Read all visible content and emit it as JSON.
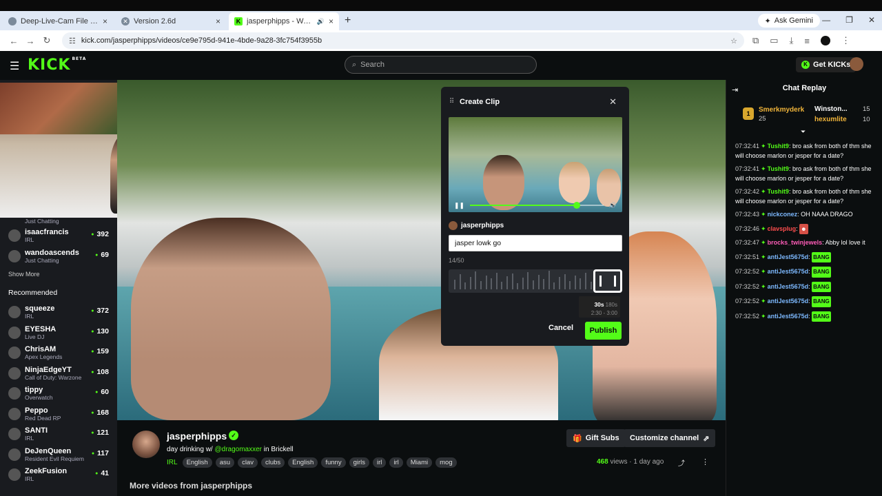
{
  "browser": {
    "tabs": [
      {
        "title": "Deep-Live-Cam File Error"
      },
      {
        "title": "Version 2.6d"
      },
      {
        "title": "jasperphipps - Watch the V"
      }
    ],
    "gemini_label": "Ask Gemini",
    "url": "kick.com/jasperphipps/videos/ce9e795d-941e-4bde-9a28-3fc754f3955b"
  },
  "header": {
    "logo": "KICK",
    "logo_badge": "BETA",
    "search_placeholder": "Search",
    "get_kicks_label": "Get KICKs"
  },
  "sidebar": {
    "following_top_category": "Just Chatting",
    "following": [
      {
        "name": "isaacfrancis",
        "category": "IRL",
        "viewers": "392"
      },
      {
        "name": "wandoascends",
        "category": "Just Chatting",
        "viewers": "69"
      }
    ],
    "show_more": "Show More",
    "recommended_title": "Recommended",
    "recommended": [
      {
        "name": "squeeze",
        "category": "IRL",
        "viewers": "372"
      },
      {
        "name": "EYESHA",
        "category": "Live DJ",
        "viewers": "130"
      },
      {
        "name": "ChrisAM",
        "category": "Apex Legends",
        "viewers": "159"
      },
      {
        "name": "NinjaEdgeYT",
        "category": "Call of Duty: Warzone",
        "viewers": "108"
      },
      {
        "name": "tippy",
        "category": "Overwatch",
        "viewers": "60"
      },
      {
        "name": "Peppo",
        "category": "Red Dead RP",
        "viewers": "168"
      },
      {
        "name": "SANTI",
        "category": "IRL",
        "viewers": "121"
      },
      {
        "name": "DeJenQueen",
        "category": "Resident Evil Requiem",
        "viewers": "117"
      },
      {
        "name": "ZeekFusion",
        "category": "IRL",
        "viewers": "41"
      }
    ]
  },
  "clip_modal": {
    "title": "Create Clip",
    "channel": "jasperphipps",
    "input_value": "jasper lowk go",
    "char_count": "14/50",
    "duration_selected": "30s",
    "duration_max": "180s",
    "range": "2:30 - 3:00",
    "cancel_label": "Cancel",
    "publish_label": "Publish",
    "playback_progress": 0.8
  },
  "chat": {
    "title": "Chat Replay",
    "leaders": [
      {
        "rank": "1",
        "name": "Smerkmyderk",
        "count": "25"
      },
      {
        "name": "Winston...",
        "count": "15"
      },
      {
        "name": "hexumlite",
        "count": "10"
      }
    ],
    "messages": [
      {
        "time": "07:32:41",
        "user": "Tushit9",
        "user_color": "#53fc18",
        "text": "bro ask from both of thm she will choose marlon or jesper for a date?"
      },
      {
        "time": "07:32:41",
        "user": "Tushit9",
        "user_color": "#53fc18",
        "text": "bro ask from both of thm she will choose marlon or jesper for a date?"
      },
      {
        "time": "07:32:42",
        "user": "Tushit9",
        "user_color": "#53fc18",
        "text": "bro ask from both of thm she will choose marlon or jesper for a date?"
      },
      {
        "time": "07:32:43",
        "user": "nickconez",
        "user_color": "#7db9ff",
        "text": "OH NAAA DRAGO"
      },
      {
        "time": "07:32:46",
        "user": "clavsplug",
        "user_color": "#ff4d4d",
        "text": ""
      },
      {
        "time": "07:32:47",
        "user": "brocks_twinjewels",
        "user_color": "#ff5cb8",
        "text": "Abby lol love it"
      },
      {
        "time": "07:32:51",
        "user": "antiJest5675d",
        "user_color": "#7db9ff",
        "text": "BANG"
      },
      {
        "time": "07:32:52",
        "user": "antiJest5675d",
        "user_color": "#7db9ff",
        "text": "BANG"
      },
      {
        "time": "07:32:52",
        "user": "antiJest5675d",
        "user_color": "#7db9ff",
        "text": "BANG"
      },
      {
        "time": "07:32:52",
        "user": "antiJest5675d",
        "user_color": "#7db9ff",
        "text": "BANG"
      },
      {
        "time": "07:32:52",
        "user": "antiJest5675d",
        "user_color": "#7db9ff",
        "text": "BANG"
      }
    ]
  },
  "stream": {
    "name": "jasperphipps",
    "title_prefix": "day drinking w/",
    "title_mention": "@dragomaxxer",
    "title_suffix": "in Brickell",
    "tags": [
      "IRL",
      "English",
      "asu",
      "clav",
      "clubs",
      "English",
      "funny",
      "girls",
      "irl",
      "irl",
      "Miami",
      "mog"
    ],
    "gift_subs_label": "Gift Subs",
    "customize_label": "Customize channel",
    "views": "468",
    "views_label": "views",
    "age": "1 day ago",
    "more_videos": "More videos from jasperphipps"
  },
  "colors": {
    "accent": "#53fc18",
    "bg": "#0b0e0f",
    "panel": "#191b1f"
  }
}
